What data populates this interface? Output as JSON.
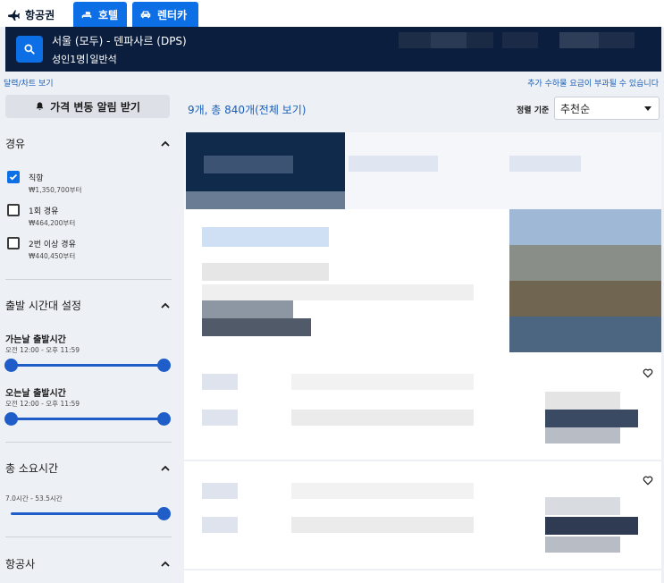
{
  "tabs": [
    {
      "label": "항공권",
      "icon": "plane-icon"
    },
    {
      "label": "호텔",
      "icon": "bed-icon"
    },
    {
      "label": "렌터카",
      "icon": "car-icon"
    }
  ],
  "search": {
    "route": "서울 (모두) - 덴파사르 (DPS)",
    "passengers": "성인1명",
    "cabin": "일반석"
  },
  "links": {
    "calendar": "달력/차트 보기",
    "fee_notice": "추가 수하물 요금이 부과될 수 있습니다"
  },
  "alert_button": "가격 변동 알림 받기",
  "results": {
    "count_text": "9개, 총 840개(전체 보기)"
  },
  "sort": {
    "label": "정렬 기준",
    "value": "추천순"
  },
  "filters": {
    "stops": {
      "title": "경유",
      "options": [
        {
          "label": "직항",
          "price": "₩1,350,700부터",
          "checked": true
        },
        {
          "label": "1회 경유",
          "price": "₩464,200부터",
          "checked": false
        },
        {
          "label": "2번 이상 경유",
          "price": "₩440,450부터",
          "checked": false
        }
      ]
    },
    "departure_time": {
      "title": "출발 시간대 설정",
      "outbound": {
        "label": "가는날 출발시간",
        "range": "오전 12:00 - 오후 11:59"
      },
      "inbound": {
        "label": "오는날 출발시간",
        "range": "오전 12:00 - 오후 11:59"
      }
    },
    "duration": {
      "title": "총 소요시간",
      "range": "7.0시간 - 53.5시간"
    },
    "airlines": {
      "title": "항공사"
    }
  },
  "colors": {
    "brand_blue": "#0d6fe6",
    "navy": "#0b1e3d",
    "slider_blue": "#1f5ec9",
    "link_blue": "#1b5fb8"
  }
}
